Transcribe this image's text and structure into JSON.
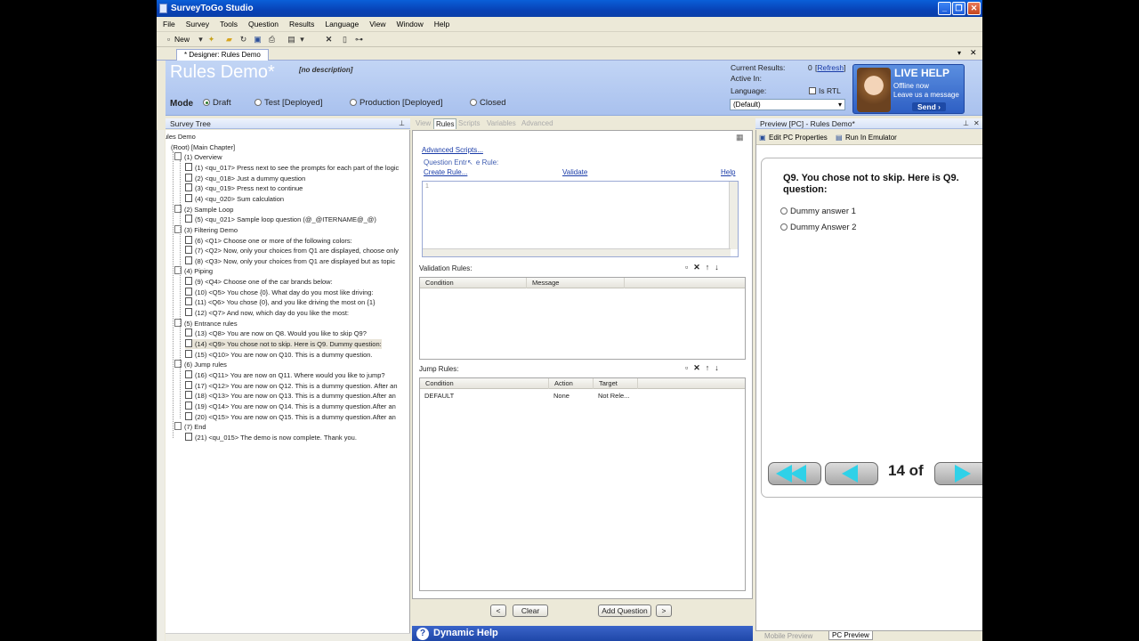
{
  "window": {
    "title": "SurveyToGo Studio"
  },
  "menu": [
    "File",
    "Survey",
    "Tools",
    "Question",
    "Results",
    "Language",
    "View",
    "Window",
    "Help"
  ],
  "toolbar": {
    "new_label": "New"
  },
  "doc_tab": "* Designer: Rules Demo",
  "header": {
    "title": "Rules Demo*",
    "description": "[no description]",
    "mode_label": "Mode",
    "modes": [
      "Draft",
      "Test [Deployed]",
      "Production [Deployed]",
      "Closed"
    ],
    "current_results_label": "Current Results:",
    "current_results_value": "0",
    "refresh_label": "Refresh",
    "active_in_label": "Active In:",
    "language_label": "Language:",
    "is_rtl_label": "Is RTL",
    "language_value": "(Default)"
  },
  "live_help": {
    "title": "LIVE HELP",
    "line1": "Offline now",
    "line2": "Leave us a message",
    "send": "Send ›"
  },
  "survey_tree": {
    "header": "Survey Tree",
    "rows": [
      "ules Demo",
      "(Root) [Main Chapter]",
      "(1) Overview",
      "(1) <qu_017> Press next to see the prompts for each part of the logic",
      "(2) <qu_018> Just a dummy question",
      "(3) <qu_019> Press next to continue",
      "(4) <qu_020> Sum calculation",
      "(2) Sample Loop",
      "(5) <qu_021> Sample loop question (@_@ITERNAME@_@)",
      "(3) Filtering Demo",
      "(6) <Q1> Choose one or more of the following colors:",
      "(7) <Q2> Now, only your choices from Q1 are displayed, choose only",
      "(8) <Q3> Now, only your choices from Q1 are displayed but as topic",
      "(4) Piping",
      "(9) <Q4> Choose one of the car brands below:",
      "(10) <Q5> You chose {0}. What day do you most like driving:",
      "(11) <Q6> You chose {0}, and you like driving the most on {1}",
      "(12) <Q7> And now, which day do you like the most:",
      "(5) Entrance rules",
      "(13) <Q8> You are now on Q8. Would you like to skip Q9?",
      "(14) <Q9> You chose not to skip. Here is Q9. Dummy question:",
      "(15) <Q10> You are now on Q10. This is a dummy question.",
      "(6) Jump rules",
      "(16) <Q11> You are now on Q11. Where would you like to jump?",
      "(17) <Q12> You are now on Q12. This is a dummy question. After an",
      "(18) <Q13> You are now on Q13. This is a dummy question.After an",
      "(19) <Q14> You are now on Q14. This is a dummy question.After an",
      "(20) <Q15> You are now on Q15. This is a dummy question.After an",
      "(7) End",
      "(21) <qu_015> The demo is now complete. Thank you."
    ]
  },
  "mid_tabs": [
    "View",
    "Rules",
    "Scripts",
    "Variables",
    "Advanced"
  ],
  "rules": {
    "advanced_scripts": "Advanced Scripts...",
    "entrance_rule_label": "Question Entr",
    "entrance_rule_suffix": "e Rule:",
    "create_rule": "Create Rule...",
    "validate": "Validate",
    "help": "Help",
    "line_number": "1",
    "validation_label": "Validation Rules:",
    "validation_columns": [
      "Condition",
      "Message"
    ],
    "jump_label": "Jump Rules:",
    "jump_columns": [
      "Condition",
      "Action",
      "Target"
    ],
    "jump_rows": [
      {
        "condition": "DEFAULT",
        "action": "None",
        "target": "Not Rele..."
      }
    ]
  },
  "bottom_buttons": {
    "prev": "<",
    "clear": "Clear",
    "add_question": "Add Question",
    "next": ">"
  },
  "dynamic_help": "Dynamic Help",
  "preview": {
    "header": "Preview [PC] - Rules Demo*",
    "edit_props": "Edit PC Properties",
    "run_emulator": "Run In Emulator",
    "question": "Q9. You chose not to skip. Here is Q9. question:",
    "answers": [
      "Dummy answer 1",
      "Dummy Answer 2"
    ],
    "pager": "14 of",
    "tabs": [
      "Mobile Preview",
      "PC Preview"
    ]
  }
}
